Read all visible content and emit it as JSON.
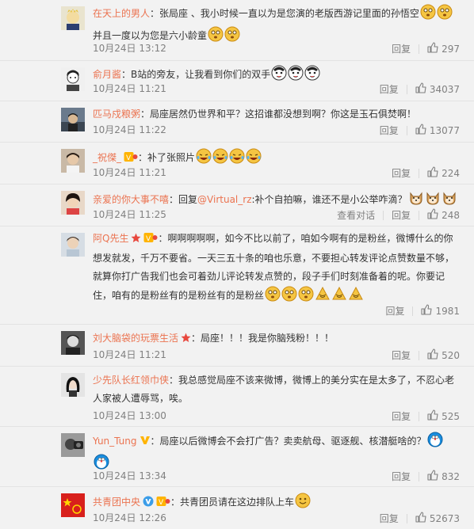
{
  "ui": {
    "reply_label": "回复",
    "dialog_label": "查看对话"
  },
  "comments": [
    {
      "user": "在天上的男人",
      "colon": "：",
      "text": "张局座 、我小时候一直以为是您演的老版西游记里面的孙悟空",
      "text2": "并且一度以为您是六小龄童",
      "time": "10月24日 13:12",
      "likes": "297"
    },
    {
      "user": "俞月酱",
      "colon": "：",
      "text": "B站的旁友，让我看到你们的双手",
      "time": "10月24日 11:21",
      "likes": "34037"
    },
    {
      "user": "匹马戍粮粥",
      "colon": "：",
      "text": "局座居然仍世界和平？这招谁都没想到啊？你这是玉石俱焚啊！",
      "time": "10月24日 11:22",
      "likes": "13077"
    },
    {
      "user": "_祝傑_",
      "colon": "：",
      "text": "补了张照片",
      "time": "10月24日 11:21",
      "likes": "224"
    },
    {
      "user": "亲爱的你大事不嘻",
      "colon": "：",
      "text_prefix": "回复",
      "mention": "@Virtual_rz",
      "text": ":补个自拍嘛，谁还不是小公举咋滴？",
      "time": "10月24日 11:25",
      "likes": "248"
    },
    {
      "user": "阿Q先生",
      "colon": "：",
      "text": "啊啊啊啊啊，如今不比以前了，咱如今啊有的是粉丝，微博什么的你想发就发，千万不要省。一天三五十条的咱也乐意，不要担心转发评论点赞数量不够，就算你打广告我们也会可着劲儿评论转发点赞的，段子手们时刻准备着的呢。你要记住，咱有的是粉丝有的是粉丝有的是粉丝",
      "time": "",
      "likes": "1981"
    },
    {
      "user": "刘大脑袋的玩票生活",
      "colon": "：",
      "text": "局座！！！我是你脑残粉！！！",
      "time": "10月24日 11:21",
      "likes": "520"
    },
    {
      "user": "少先队长红领巾侠",
      "colon": "：",
      "text": "我总感觉局座不该来微博，微博上的美分实在是太多了，不忍心老人家被人遭辱骂，唉。",
      "time": "10月24日 13:00",
      "likes": "525"
    },
    {
      "user": "Yun_Tung",
      "colon": "：",
      "text": "局座以后微博会不会打广告？卖卖航母、驱逐舰、核潜艇啥的？",
      "time": "10月24日 13:34",
      "likes": "832"
    },
    {
      "user": "共青团中央",
      "colon": "：",
      "text": "共青团员请在这边排队上车",
      "time": "10月24日 12:26",
      "likes": "52673"
    }
  ]
}
